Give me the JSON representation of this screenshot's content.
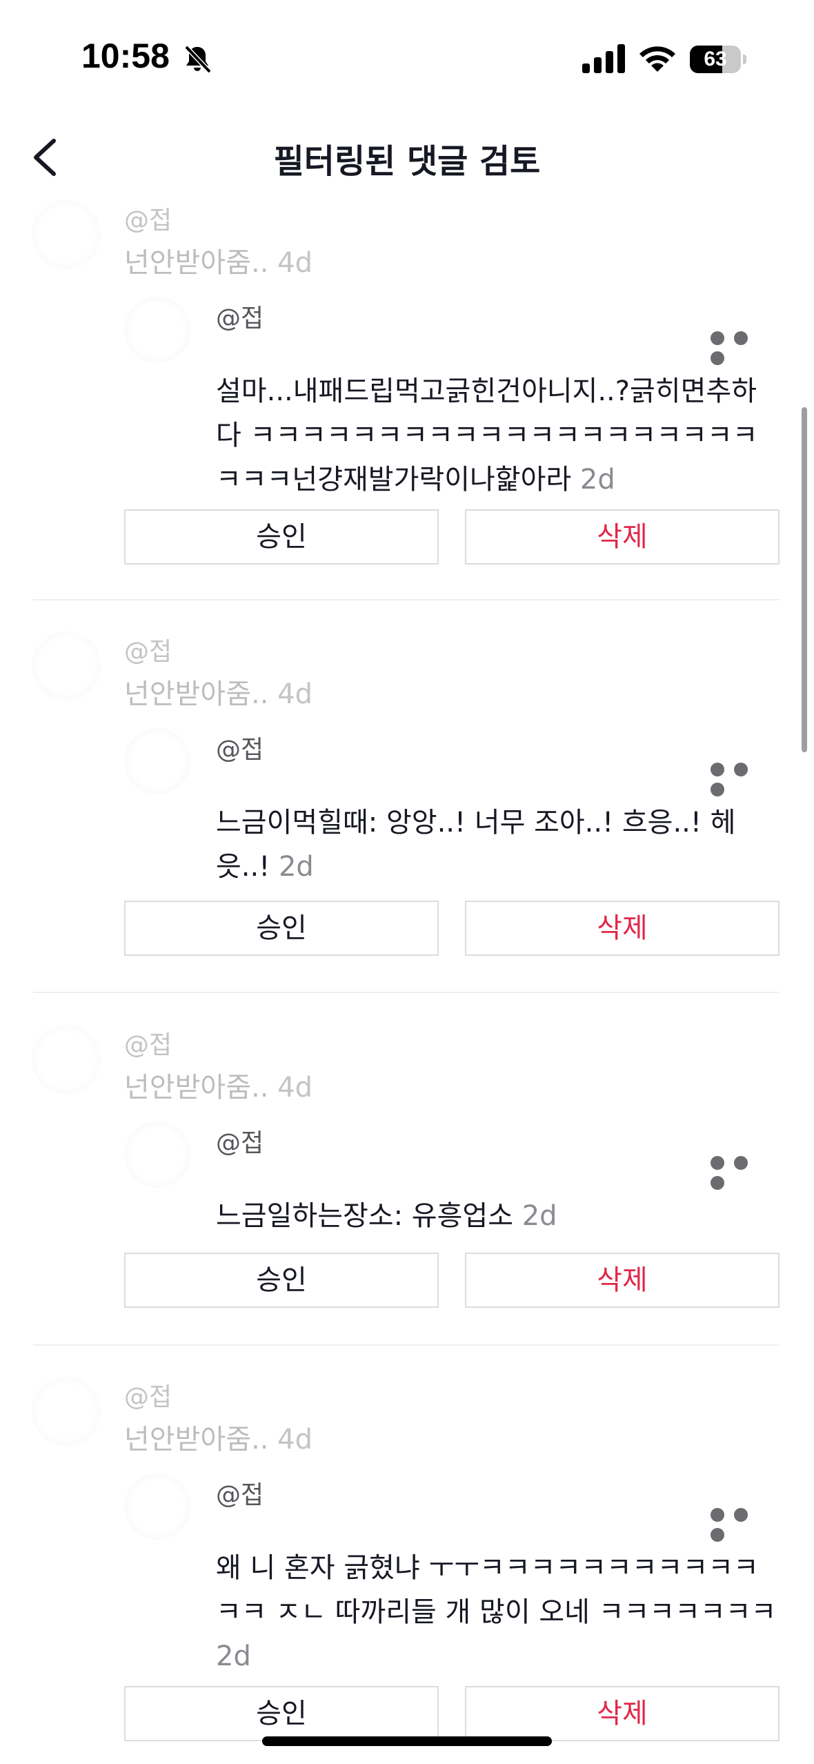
{
  "status_bar": {
    "time": "10:58",
    "battery": "63",
    "battery_level_percent": 63,
    "icons": [
      "bell-slash-icon",
      "signal-icon",
      "wifi-icon",
      "battery-icon"
    ]
  },
  "header": {
    "title": "필터링된 댓글 검토",
    "back_icon": "chevron-left-icon"
  },
  "comments": [
    {
      "parent_user": "@접",
      "parent_text": "넌안받아줌..",
      "parent_time": "4d",
      "child_user": "@접",
      "child_text": "설마...내패드립먹고긁힌건아니지..?긁히면추하다 ㅋㅋㅋㅋㅋㅋㅋㅋㅋㅋㅋㅋㅋㅋㅋㅋㅋㅋㅋㅋㅋㅋㅋ넌걍재발가락이나핥아라",
      "child_time": "2d",
      "approve_label": "승인",
      "delete_label": "삭제"
    },
    {
      "parent_user": "@접",
      "parent_text": "넌안받아줌..",
      "parent_time": "4d",
      "child_user": "@접",
      "child_text": "느금이먹힐때: 앙앙..! 너무 조아..! 흐응..! 헤읏..!",
      "child_time": "2d",
      "approve_label": "승인",
      "delete_label": "삭제"
    },
    {
      "parent_user": "@접",
      "parent_text": "넌안받아줌..",
      "parent_time": "4d",
      "child_user": "@접",
      "child_text": "느금일하는장소: 유흥업소",
      "child_time": "2d",
      "approve_label": "승인",
      "delete_label": "삭제"
    },
    {
      "parent_user": "@접",
      "parent_text": "넌안받아줌..",
      "parent_time": "4d",
      "child_user": "@접",
      "child_text": "왜 니 혼자 긁혔냐 ㅜㅜㅋㅋㅋㅋㅋㅋㅋㅋㅋㅋㅋㅋㅋ ㅈㄴ 따까리들 개 많이 오네 ㅋㅋㅋㅋㅋㅋㅋ",
      "child_time": "2d",
      "approve_label": "승인",
      "delete_label": "삭제"
    }
  ],
  "colors": {
    "delete_text": "#e0294a",
    "muted_text": "#bdbdc0",
    "border": "#dcdcdf"
  }
}
